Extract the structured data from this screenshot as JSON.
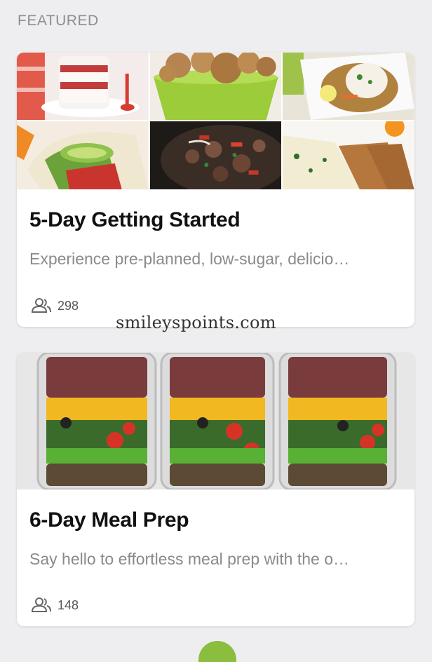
{
  "section": {
    "label": "FEATURED"
  },
  "cards": [
    {
      "title": "5-Day Getting Started",
      "description": "Experience pre-planned, low-sugar, delicio…",
      "members_icon": "people-icon",
      "members_count": "298"
    },
    {
      "title": "6-Day Meal Prep",
      "description": "Say hello to effortless meal prep with the o…",
      "members_icon": "people-icon",
      "members_count": "148"
    }
  ],
  "watermark": "smileyspoints.com",
  "colors": {
    "background": "#eeeef0",
    "card": "#ffffff",
    "title": "#111111",
    "description": "#8a8a8a",
    "accent_green": "#8bbd3e"
  }
}
